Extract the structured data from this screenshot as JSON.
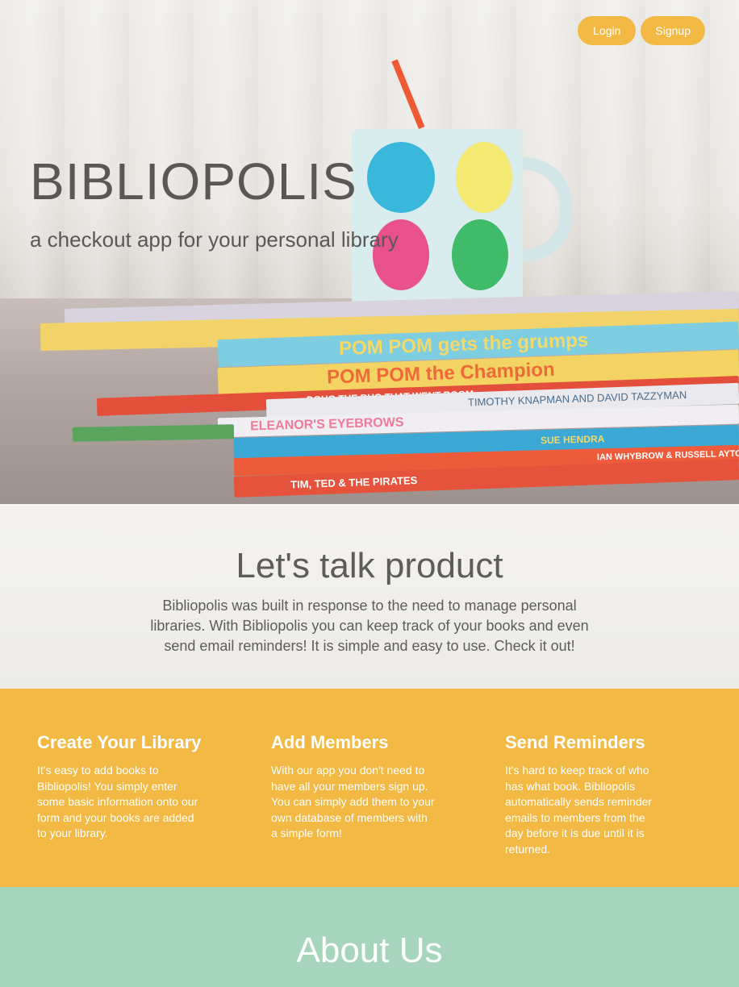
{
  "nav": {
    "login_label": "Login",
    "signup_label": "Signup"
  },
  "hero": {
    "brand": "BIBLIOPOLIS",
    "tagline": "a checkout app for your personal library",
    "books": [
      "POM POM gets the grumps",
      "POM POM the Champion",
      "DOUG THE BUG THAT WENT BOOM",
      "TIMOTHY KNAPMAN AND DAVID TAZZYMAN",
      "ELEANOR'S EYEBROWS",
      "SUE HENDRA",
      "IAN WHYBROW & RUSSELL AYTO",
      "TIM, TED & THE PIRATES"
    ]
  },
  "product": {
    "title": "Let's talk product",
    "body": "Bibliopolis was built in response to the need to manage personal libraries. With Bibliopolis you can keep track of your books and even send email reminders! It is simple and easy to use. Check it out!"
  },
  "features": [
    {
      "title": "Create Your Library",
      "body": "It's easy to add books to Bibliopolis! You simply enter some basic information onto our form and your books are added to your library."
    },
    {
      "title": "Add Members",
      "body": "With our app you don't need to have all your members sign up. You can simply add them to your own database of members with a simple form!"
    },
    {
      "title": "Send Reminders",
      "body": "It's hard to keep track of who has what book. Bibliopolis automatically sends reminder emails to members from the day before it is due until it is returned."
    }
  ],
  "about": {
    "title": "About Us"
  },
  "colors": {
    "accent": "#f2b944",
    "about_bg": "#a6d5bc",
    "text": "#5e5c59"
  }
}
